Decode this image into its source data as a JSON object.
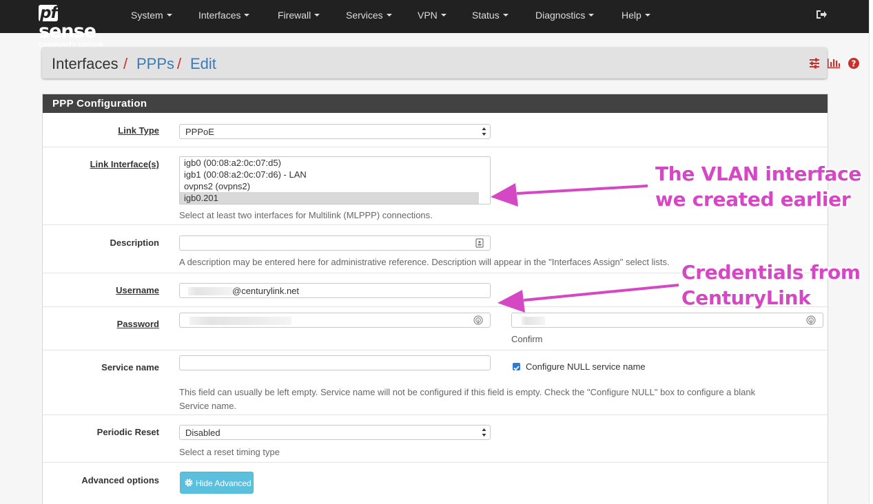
{
  "brand": {
    "logo_prefix": "pf",
    "logo_suffix": "sense",
    "subtitle": "COMMUNITY EDITION"
  },
  "nav": {
    "items": [
      "System",
      "Interfaces",
      "Firewall",
      "Services",
      "VPN",
      "Status",
      "Diagnostics",
      "Help"
    ]
  },
  "breadcrumb": {
    "root": "Interfaces",
    "level2": "PPPs",
    "level3": "Edit",
    "separator": "/"
  },
  "panel": {
    "title": "PPP Configuration"
  },
  "form": {
    "link_type": {
      "label": "Link Type",
      "value": "PPPoE"
    },
    "link_interfaces": {
      "label": "Link Interface(s)",
      "options": [
        "igb0 (00:08:a2:0c:07:d5)",
        "igb1 (00:08:a2:0c:07:d6) - LAN",
        "ovpns2 (ovpns2)",
        "igb0.201"
      ],
      "selected": "igb0.201",
      "help": "Select at least two interfaces for Multilink (MLPPP) connections."
    },
    "description": {
      "label": "Description",
      "value": "",
      "help": "A description may be entered here for administrative reference. Description will appear in the \"Interfaces Assign\" select lists."
    },
    "username": {
      "label": "Username",
      "value_suffix": "@centurylink.net"
    },
    "password": {
      "label": "Password",
      "confirm_label": "Confirm"
    },
    "service_name": {
      "label": "Service name",
      "value": "",
      "null_checkbox_label": "Configure NULL service name",
      "null_checked": true,
      "help_line1": "This field can usually be left empty. Service name will not be configured if this field is empty. Check the \"Configure NULL\" box to configure a blank",
      "help_line2": "Service name."
    },
    "periodic_reset": {
      "label": "Periodic Reset",
      "value": "Disabled",
      "help": "Select a reset timing type"
    },
    "advanced": {
      "label": "Advanced options",
      "button_label": "Hide Advanced"
    }
  },
  "annotations": {
    "vlan_line1": "The VLAN interface",
    "vlan_line2": "we created earlier",
    "cred_line1": "Credentials from",
    "cred_line2": "CenturyLink"
  },
  "colors": {
    "navbar": "#212121",
    "panel_head": "#424242",
    "link": "#3a7ab6",
    "separator": "#c9302c",
    "annotation": "#d548c4",
    "info_button": "#5bc0de"
  }
}
